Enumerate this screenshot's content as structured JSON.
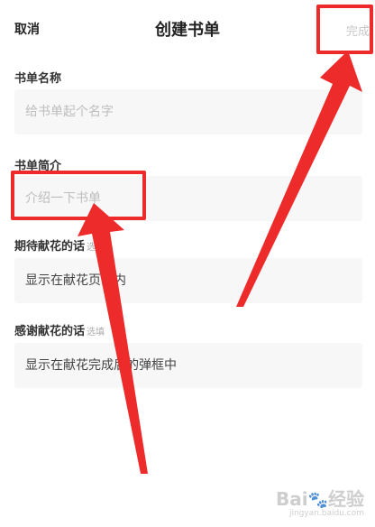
{
  "header": {
    "cancel_label": "取消",
    "title": "创建书单",
    "done_label": "完成"
  },
  "fields": [
    {
      "label": "书单名称",
      "hint": "",
      "placeholder": "给书单起个名字"
    },
    {
      "label": "书单简介",
      "hint": "",
      "placeholder": "介绍一下书单"
    },
    {
      "label": "期待献花的话",
      "hint": "选填",
      "placeholder": "显示在献花页面内"
    },
    {
      "label": "感谢献花的话",
      "hint": "选填",
      "placeholder": "显示在献花完成后的弹框中"
    }
  ],
  "annotation": {
    "color": "#ee2b2b"
  },
  "watermark": {
    "logo_text": "Bai",
    "logo_suffix": "经验",
    "url": "jingyan.baidu.com"
  }
}
